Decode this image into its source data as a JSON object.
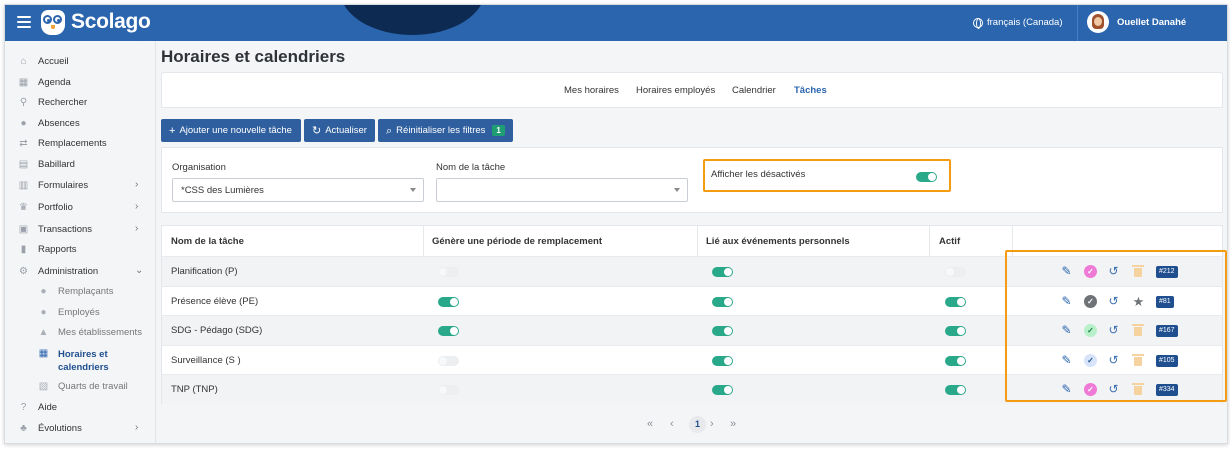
{
  "header": {
    "brand": "Scolago",
    "language": "français (Canada)",
    "user_name": "Ouellet Danahé"
  },
  "sidebar": {
    "items": [
      {
        "label": "Accueil",
        "icon": "home-icon"
      },
      {
        "label": "Agenda",
        "icon": "calendar-icon"
      },
      {
        "label": "Rechercher",
        "icon": "search-icon"
      },
      {
        "label": "Absences",
        "icon": "absence-icon"
      },
      {
        "label": "Remplacements",
        "icon": "replacement-icon"
      },
      {
        "label": "Babillard",
        "icon": "board-icon"
      },
      {
        "label": "Formulaires",
        "icon": "form-icon"
      },
      {
        "label": "Portfolio",
        "icon": "trophy-icon"
      },
      {
        "label": "Transactions",
        "icon": "transactions-icon"
      },
      {
        "label": "Rapports",
        "icon": "reports-icon"
      },
      {
        "label": "Administration",
        "icon": "gear-icon"
      },
      {
        "label": "Aide",
        "icon": "help-icon"
      },
      {
        "label": "Évolutions",
        "icon": "sprout-icon"
      }
    ],
    "sub_items": [
      {
        "label": "Remplaçants"
      },
      {
        "label": "Employés"
      },
      {
        "label": "Mes établissements"
      },
      {
        "label": "Horaires et calendriers",
        "line1": "Horaires et",
        "line2": "calendriers"
      },
      {
        "label": "Quarts de travail"
      }
    ]
  },
  "page": {
    "title": "Horaires et calendriers"
  },
  "tabs": [
    {
      "label": "Mes horaires"
    },
    {
      "label": "Horaires employés"
    },
    {
      "label": "Calendrier"
    },
    {
      "label": "Tâches",
      "active": true
    }
  ],
  "toolbar": {
    "add_label": "Ajouter une nouvelle tâche",
    "refresh_label": "Actualiser",
    "reset_label": "Réinitialiser les filtres",
    "reset_count": "1"
  },
  "filters": {
    "organisation_label": "Organisation",
    "organisation_value": "*CSS des Lumières",
    "task_name_label": "Nom de la tâche",
    "task_name_value": "",
    "show_disabled_label": "Afficher les désactivés",
    "show_disabled": true
  },
  "table": {
    "columns": [
      "Nom de la tâche",
      "Génère une période de remplacement",
      "Lié aux événements personnels",
      "Actif"
    ],
    "rows": [
      {
        "name": "Planification (P)",
        "generates": false,
        "linked": true,
        "active": false,
        "status": "pink",
        "fourth_action": "trash",
        "id": "#212"
      },
      {
        "name": "Présence élève (PE)",
        "generates": true,
        "linked": true,
        "active": true,
        "status": "gray",
        "fourth_action": "star",
        "id": "#81"
      },
      {
        "name": "SDG - Pédago (SDG)",
        "generates": true,
        "linked": true,
        "active": true,
        "status": "green",
        "fourth_action": "trash",
        "id": "#167"
      },
      {
        "name": "Surveillance (S )",
        "generates": false,
        "linked": true,
        "active": true,
        "status": "blue",
        "fourth_action": "trash",
        "id": "#105"
      },
      {
        "name": "TNP (TNP)",
        "generates": false,
        "linked": true,
        "active": true,
        "status": "pink",
        "fourth_action": "trash",
        "id": "#334"
      }
    ]
  },
  "pagination": {
    "first": "«",
    "prev": "‹",
    "current": "1",
    "next": "›",
    "last": "»"
  },
  "colors": {
    "brand_blue": "#2a65ae",
    "button_blue": "#2f5f9e",
    "toggle_on": "#2aa88a",
    "highlight": "#f39c12"
  }
}
